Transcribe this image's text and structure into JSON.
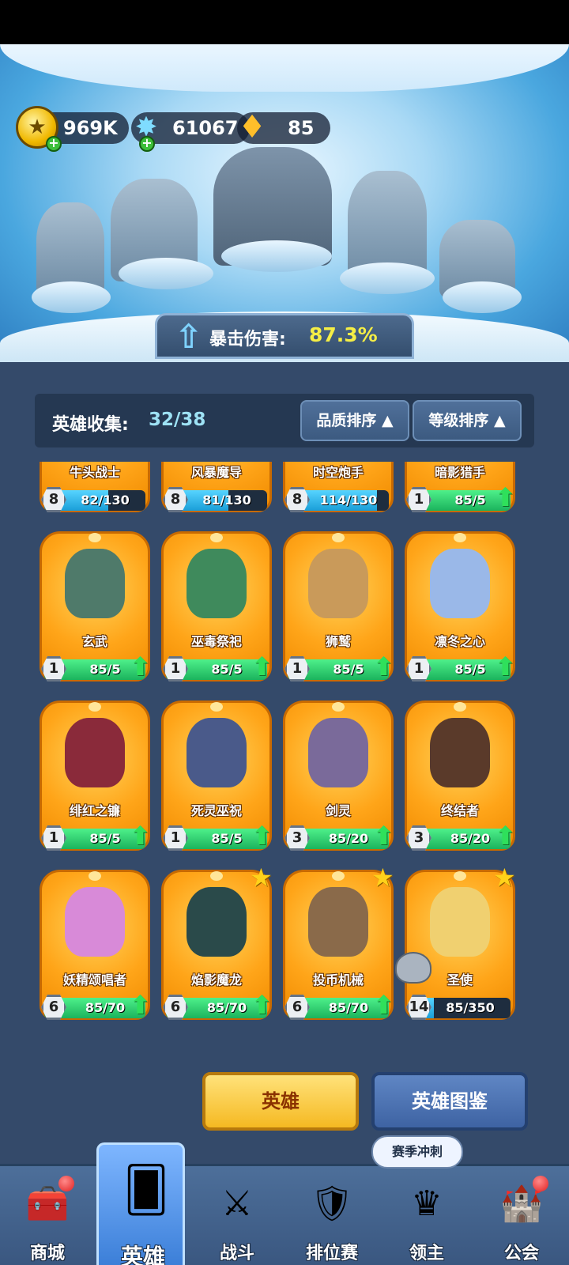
{
  "resources": [
    {
      "id": "gold",
      "value": "969K",
      "icon": "gold-coin-icon",
      "has_plus": true
    },
    {
      "id": "crystal",
      "value": "61067",
      "icon": "blue-crystal-icon",
      "has_plus": true
    },
    {
      "id": "gem",
      "value": "85",
      "icon": "gold-gem-icon",
      "has_plus": false
    }
  ],
  "crit": {
    "label": "暴击伤害:",
    "value": "87.3%"
  },
  "collection": {
    "label": "英雄收集:",
    "count": "32/38"
  },
  "sort": {
    "quality": "品质排序 ▲",
    "level": "等级排序 ▲"
  },
  "heroes": [
    {
      "name": "牛头战士",
      "level": "8",
      "progress": "82/130",
      "fill": 0.63,
      "bar": "blue",
      "upgrade": false,
      "star": false
    },
    {
      "name": "风暴魔导",
      "level": "8",
      "progress": "81/130",
      "fill": 0.62,
      "bar": "blue",
      "upgrade": false,
      "star": false
    },
    {
      "name": "时空炮手",
      "level": "8",
      "progress": "114/130",
      "fill": 0.88,
      "bar": "blue",
      "upgrade": false,
      "star": false
    },
    {
      "name": "暗影猎手",
      "level": "1",
      "progress": "85/5",
      "fill": 1,
      "bar": "green",
      "upgrade": true,
      "star": false
    },
    {
      "name": "玄武",
      "level": "1",
      "progress": "85/5",
      "fill": 1,
      "bar": "green",
      "upgrade": true,
      "star": false
    },
    {
      "name": "巫毒祭祀",
      "level": "1",
      "progress": "85/5",
      "fill": 1,
      "bar": "green",
      "upgrade": true,
      "star": false
    },
    {
      "name": "狮鹫",
      "level": "1",
      "progress": "85/5",
      "fill": 1,
      "bar": "green",
      "upgrade": true,
      "star": false
    },
    {
      "name": "凛冬之心",
      "level": "1",
      "progress": "85/5",
      "fill": 1,
      "bar": "green",
      "upgrade": true,
      "star": false
    },
    {
      "name": "绯红之镰",
      "level": "1",
      "progress": "85/5",
      "fill": 1,
      "bar": "green",
      "upgrade": true,
      "star": false
    },
    {
      "name": "死灵巫祝",
      "level": "1",
      "progress": "85/5",
      "fill": 1,
      "bar": "green",
      "upgrade": true,
      "star": false
    },
    {
      "name": "剑灵",
      "level": "3",
      "progress": "85/20",
      "fill": 1,
      "bar": "green",
      "upgrade": true,
      "star": false
    },
    {
      "name": "终结者",
      "level": "3",
      "progress": "85/20",
      "fill": 1,
      "bar": "green",
      "upgrade": true,
      "star": false
    },
    {
      "name": "妖精颂唱者",
      "level": "6",
      "progress": "85/70",
      "fill": 1,
      "bar": "green",
      "upgrade": true,
      "star": false
    },
    {
      "name": "焰影魔龙",
      "level": "6",
      "progress": "85/70",
      "fill": 1,
      "bar": "green",
      "upgrade": true,
      "star": true
    },
    {
      "name": "投币机械",
      "level": "6",
      "progress": "85/70",
      "fill": 1,
      "bar": "green",
      "upgrade": true,
      "star": true
    },
    {
      "name": "圣使",
      "level": "14",
      "progress": "85/350",
      "fill": 0.24,
      "bar": "blue",
      "upgrade": false,
      "star": true
    }
  ],
  "buttons": {
    "heroes": "英雄",
    "codex": "英雄图鉴"
  },
  "event_bubble": "赛季冲刺",
  "nav": [
    {
      "label": "商城",
      "icon": "shop-chest-icon",
      "badge": true,
      "active": false
    },
    {
      "label": "英雄",
      "icon": "hero-card-icon",
      "badge": false,
      "active": true
    },
    {
      "label": "战斗",
      "icon": "crossed-swords-icon",
      "badge": false,
      "active": false
    },
    {
      "label": "排位赛",
      "icon": "rank-shield-icon",
      "badge": false,
      "active": false
    },
    {
      "label": "领主",
      "icon": "lord-banner-icon",
      "badge": false,
      "active": false
    },
    {
      "label": "公会",
      "icon": "guild-castle-icon",
      "badge": true,
      "active": false
    }
  ],
  "colors": {
    "accent_yellow": "#f5ee45",
    "collect_count": "#9ee2f5",
    "card_orange": "#ffa519",
    "bar_green": "#1bb35d",
    "bar_blue": "#1a9ed8"
  }
}
